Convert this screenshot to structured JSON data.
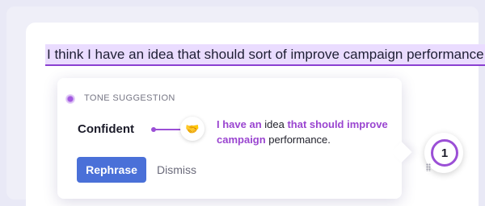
{
  "editor": {
    "sentence": "I think I have an idea that should sort of improve campaign performance."
  },
  "suggestion_card": {
    "tone_label": "TONE SUGGESTION",
    "tone_name": "Confident",
    "emoji_icon": "handshake-icon",
    "rewrite": {
      "part1": "I have an",
      "part2": " idea ",
      "part3": "that should improve campaign",
      "part4": " performance."
    },
    "rephrase_label": "Rephrase",
    "dismiss_label": "Dismiss"
  },
  "suggestion_counter": {
    "count": "1"
  },
  "colors": {
    "accent_purple": "#9b4fd6",
    "highlight_bg": "#eadcff",
    "primary_button": "#4a70d8"
  }
}
